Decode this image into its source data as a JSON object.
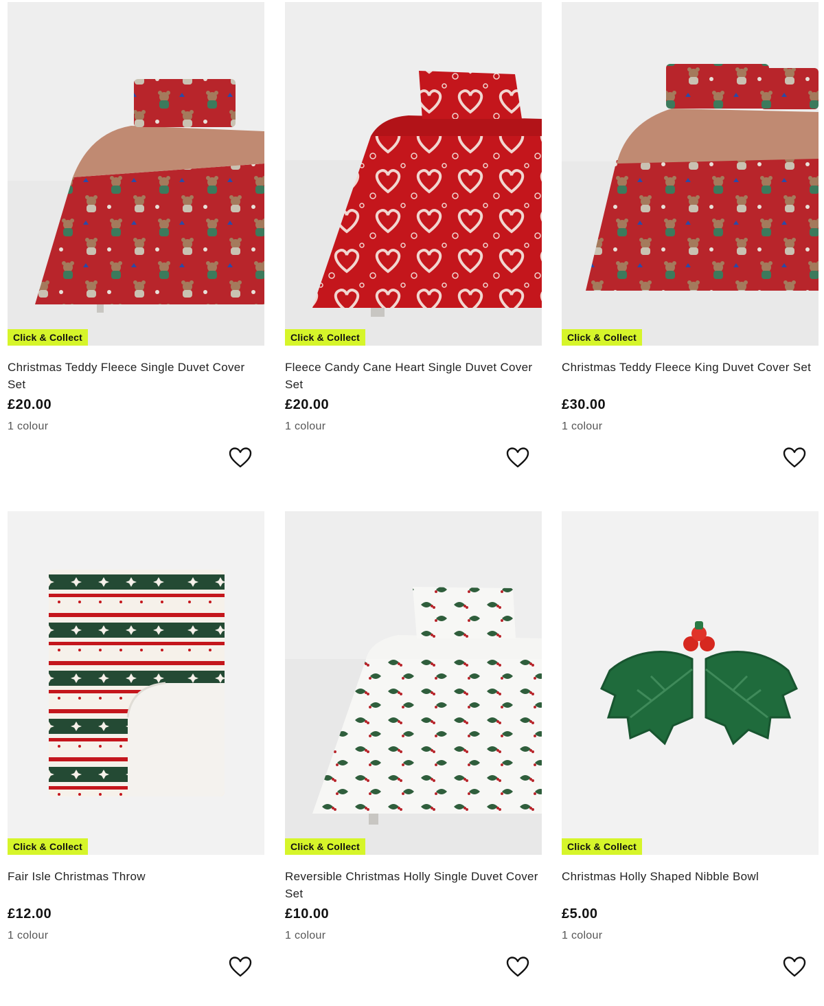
{
  "colors": {
    "badge_bg": "#d6f52a",
    "price_text": "#111111"
  },
  "products": [
    {
      "badge": "Click & Collect",
      "title": "Christmas Teddy Fleece Single Duvet Cover Set",
      "price": "£20.00",
      "colours": "1 colour",
      "wishlist_icon": "heart-outline-icon"
    },
    {
      "badge": "Click & Collect",
      "title": "Fleece Candy Cane Heart Single Duvet Cover Set",
      "price": "£20.00",
      "colours": "1 colour",
      "wishlist_icon": "heart-outline-icon"
    },
    {
      "badge": "Click & Collect",
      "title": "Christmas Teddy Fleece King Duvet Cover Set",
      "price": "£30.00",
      "colours": "1 colour",
      "wishlist_icon": "heart-outline-icon"
    },
    {
      "badge": "Click & Collect",
      "title": "Fair Isle Christmas Throw",
      "price": "£12.00",
      "colours": "1 colour",
      "wishlist_icon": "heart-outline-icon"
    },
    {
      "badge": "Click & Collect",
      "title": "Reversible Christmas Holly Single Duvet Cover Set",
      "price": "£10.00",
      "colours": "1 colour",
      "wishlist_icon": "heart-outline-icon"
    },
    {
      "badge": "Click & Collect",
      "title": "Christmas Holly Shaped Nibble Bowl",
      "price": "£5.00",
      "colours": "1 colour",
      "wishlist_icon": "heart-outline-icon"
    }
  ]
}
